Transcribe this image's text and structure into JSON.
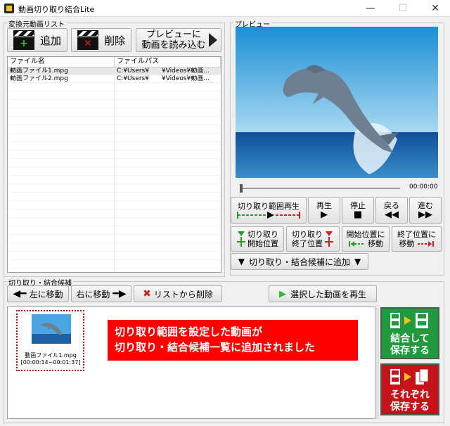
{
  "window": {
    "title": "動画切り取り結合Lite",
    "min_glyph": "—",
    "max_glyph": "☐",
    "close_glyph": "✕"
  },
  "source_list": {
    "group_label": "変換元動画リスト",
    "add_label": "追加",
    "delete_label": "削除",
    "preview_label_1": "プレビューに",
    "preview_label_2": "動画を読み込む",
    "columns": [
      "ファイル名",
      "ファイルパス"
    ],
    "rows": [
      {
        "name": "動画ファイル1.mpg",
        "path": "C:¥Users¥　　¥Videos¥動画..."
      },
      {
        "name": "動画ファイル2.mpg",
        "path": "C:¥Users¥　　¥Videos¥動画..."
      }
    ]
  },
  "preview": {
    "group_label": "プレビュー",
    "time": "00:00:00",
    "seek_position": 0
  },
  "controls": {
    "play_range": "切り取り範囲再生",
    "play": "再生",
    "stop": "停止",
    "back": "戻る",
    "forward": "進む",
    "cut_start_1": "切り取り",
    "cut_start_2": "開始位置",
    "cut_end_1": "切り取り",
    "cut_end_2": "終了位置",
    "move_start_1": "開始位置に",
    "move_start_2": "移動",
    "move_end_1": "終了位置に",
    "move_end_2": "移動",
    "add_candidate": "切り取り・結合候補に追加"
  },
  "candidates": {
    "group_label": "切り取り・結合候補",
    "move_left": "左に移動",
    "move_right": "右に移動",
    "remove": "リストから削除",
    "play_selected": "選択した動画を再生",
    "items": [
      {
        "name": "動画ファイル1.mpg",
        "range": "[00:00:14~00:01:37]"
      }
    ],
    "banner_line1": "切り取り範囲を設定した動画が",
    "banner_line2": "切り取り・結合候補一覧に追加されました",
    "merge_save_1": "結合して",
    "merge_save_2": "保存する",
    "each_save_1": "それぞれ",
    "each_save_2": "保存する"
  },
  "colors": {
    "merge_button": "#1f9a3c",
    "each_button": "#c8121a",
    "banner": "#ff0000"
  }
}
